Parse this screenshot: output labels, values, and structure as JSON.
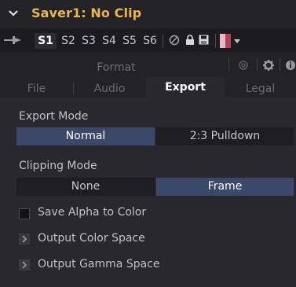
{
  "header": {
    "title": "Saver1: No Clip",
    "title_color": "#e8b84a",
    "collapse_icon": "chevron-down-icon"
  },
  "toolbar": {
    "pin_icon": "pin-icon",
    "slots": [
      {
        "label": "S1",
        "active": true
      },
      {
        "label": "S2",
        "active": false
      },
      {
        "label": "S3",
        "active": false
      },
      {
        "label": "S4",
        "active": false
      },
      {
        "label": "S5",
        "active": false
      },
      {
        "label": "S6",
        "active": false
      }
    ],
    "icons": [
      "disable-icon",
      "lock-icon",
      "save-icon",
      "color-swatch",
      "dropdown-arrow-icon"
    ],
    "swatch_colors": [
      "#e7b9c4",
      "#b24157"
    ]
  },
  "tabs": {
    "upper": [
      "Format"
    ],
    "lower": [
      "File",
      "Audio",
      "Export",
      "Legal"
    ],
    "active": "Export",
    "icons": [
      "link-icon",
      "gear-icon",
      "info-icon"
    ]
  },
  "export_mode": {
    "label": "Export Mode",
    "options": [
      "Normal",
      "2:3 Pulldown"
    ],
    "selected": "Normal"
  },
  "clipping_mode": {
    "label": "Clipping Mode",
    "options": [
      "None",
      "Frame"
    ],
    "selected": "Frame"
  },
  "save_alpha": {
    "label": "Save Alpha to Color",
    "checked": false
  },
  "output_color_space": {
    "label": "Output Color Space",
    "expanded": false
  },
  "output_gamma_space": {
    "label": "Output Gamma Space",
    "expanded": false
  },
  "accent_color": "#3b4869"
}
